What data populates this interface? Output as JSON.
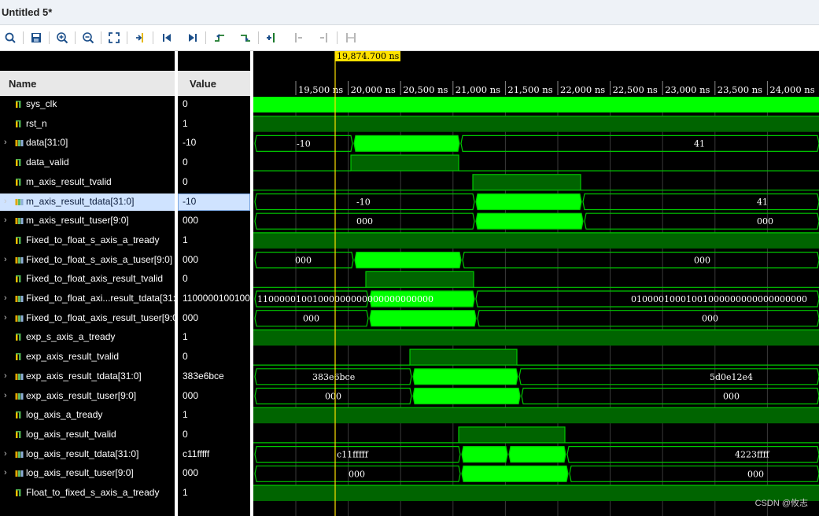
{
  "window": {
    "title": "Untitled 5*"
  },
  "toolbar": {
    "buttons": [
      {
        "name": "search-button",
        "icon": "search-icon"
      },
      {
        "name": "save-button",
        "icon": "save-icon"
      },
      {
        "name": "zoom-in-button",
        "icon": "zoom-in-icon"
      },
      {
        "name": "zoom-out-button",
        "icon": "zoom-out-icon"
      },
      {
        "name": "zoom-fit-button",
        "icon": "zoom-fit-icon"
      },
      {
        "name": "go-to-cursor-button",
        "icon": "go-to-cursor-icon"
      },
      {
        "name": "go-to-time-0-button",
        "icon": "go-to-start-icon"
      },
      {
        "name": "go-to-last-time-button",
        "icon": "go-to-end-icon"
      },
      {
        "name": "previous-transition-button",
        "icon": "previous-transition-icon"
      },
      {
        "name": "next-transition-button",
        "icon": "next-transition-icon"
      },
      {
        "name": "add-marker-button",
        "icon": "add-marker-icon"
      },
      {
        "name": "previous-marker-button",
        "icon": "previous-marker-icon"
      },
      {
        "name": "next-marker-button",
        "icon": "next-marker-icon"
      },
      {
        "name": "swap-cursors-button",
        "icon": "swap-cursors-icon"
      }
    ]
  },
  "headers": {
    "name": "Name",
    "value": "Value"
  },
  "cursor": {
    "time_label": "19,874.700 ns",
    "color": "#ffe100"
  },
  "colors": {
    "wave_bright": "#00ff00",
    "wave_dark": "#006400",
    "wave_line": "#00c800",
    "selection": "#cfe3ff"
  },
  "timeline": {
    "ticks": [
      "19,500 ns",
      "20,000 ns",
      "20,500 ns",
      "21,000 ns",
      "21,500 ns",
      "22,000 ns",
      "22,500 ns",
      "23,000 ns",
      "23,500 ns",
      "24,000 ns"
    ]
  },
  "signals": [
    {
      "name": "sys_clk",
      "value": "0",
      "kind": "bit",
      "expand": false,
      "icon": "signal-bit-icon"
    },
    {
      "name": "rst_n",
      "value": "1",
      "kind": "bit",
      "expand": false,
      "icon": "signal-bit-icon"
    },
    {
      "name": "data[31:0]",
      "value": "-10",
      "kind": "bus",
      "expand": true,
      "icon": "signal-bus-icon",
      "labels": [
        "-10",
        "41"
      ]
    },
    {
      "name": "data_valid",
      "value": "0",
      "kind": "bit",
      "expand": false,
      "icon": "signal-bit-icon"
    },
    {
      "name": "m_axis_result_tvalid",
      "value": "0",
      "kind": "bit",
      "expand": false,
      "icon": "signal-bit-icon"
    },
    {
      "name": "m_axis_result_tdata[31:0]",
      "value": "-10",
      "kind": "bus",
      "expand": true,
      "icon": "signal-bus-icon",
      "selected": true,
      "labels": [
        "-10",
        "41"
      ]
    },
    {
      "name": "m_axis_result_tuser[9:0]",
      "value": "000",
      "kind": "bus",
      "expand": true,
      "icon": "signal-bus-icon",
      "labels": [
        "000",
        "000"
      ]
    },
    {
      "name": "Fixed_to_float_s_axis_a_tready",
      "value": "1",
      "kind": "bit",
      "expand": false,
      "icon": "signal-bit-icon"
    },
    {
      "name": "Fixed_to_float_s_axis_a_tuser[9:0]",
      "value": "000",
      "kind": "bus",
      "expand": true,
      "icon": "signal-bus-icon",
      "labels": [
        "000",
        "000"
      ]
    },
    {
      "name": "Fixed_to_float_axis_result_tvalid",
      "value": "0",
      "kind": "bit",
      "expand": false,
      "icon": "signal-bit-icon"
    },
    {
      "name": "Fixed_to_float_axi...result_tdata[31:0]",
      "value": "11000001001000000000000000000000",
      "kind": "bus",
      "expand": true,
      "icon": "signal-bus-icon",
      "labels": [
        "11000001001000000000000000000000",
        "01000010001001000000000000000000"
      ]
    },
    {
      "name": "Fixed_to_float_axis_result_tuser[9:0]",
      "value": "000",
      "kind": "bus",
      "expand": true,
      "icon": "signal-bus-icon",
      "labels": [
        "000",
        "000"
      ]
    },
    {
      "name": "exp_s_axis_a_tready",
      "value": "1",
      "kind": "bit",
      "expand": false,
      "icon": "signal-bit-icon"
    },
    {
      "name": "exp_axis_result_tvalid",
      "value": "0",
      "kind": "bit",
      "expand": false,
      "icon": "signal-bit-icon"
    },
    {
      "name": "exp_axis_result_tdata[31:0]",
      "value": "383e6bce",
      "kind": "bus",
      "expand": true,
      "icon": "signal-bus-icon",
      "labels": [
        "383e6bce",
        "5d0e12e4"
      ]
    },
    {
      "name": "exp_axis_result_tuser[9:0]",
      "value": "000",
      "kind": "bus",
      "expand": true,
      "icon": "signal-bus-icon",
      "labels": [
        "000",
        "000"
      ]
    },
    {
      "name": "log_axis_a_tready",
      "value": "1",
      "kind": "bit",
      "expand": false,
      "icon": "signal-bit-icon"
    },
    {
      "name": "log_axis_result_tvalid",
      "value": "0",
      "kind": "bit",
      "expand": false,
      "icon": "signal-bit-icon"
    },
    {
      "name": "log_axis_result_tdata[31:0]",
      "value": "c11fffff",
      "kind": "bus",
      "expand": true,
      "icon": "signal-bus-icon",
      "labels": [
        "c11fffff",
        "4223ffff"
      ]
    },
    {
      "name": "log_axis_result_tuser[9:0]",
      "value": "000",
      "kind": "bus",
      "expand": true,
      "icon": "signal-bus-icon",
      "labels": [
        "000",
        "000"
      ]
    },
    {
      "name": "Float_to_fixed_s_axis_a_tready",
      "value": "1",
      "kind": "bit",
      "expand": false,
      "icon": "signal-bit-icon"
    }
  ],
  "watermark": "CSDN @攸志"
}
